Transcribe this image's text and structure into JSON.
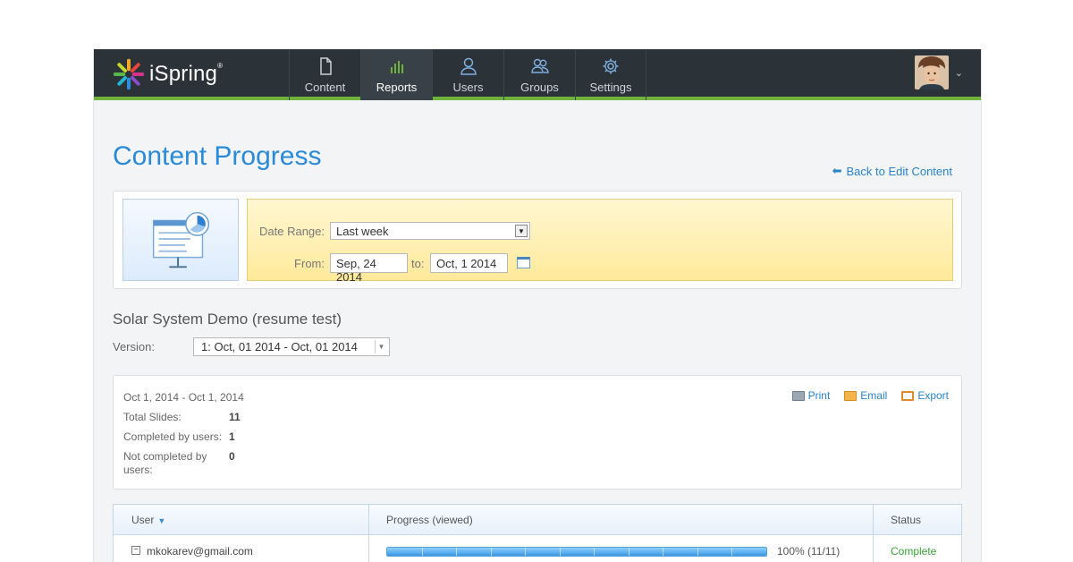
{
  "app": {
    "brand": "iSpring",
    "brand_mark": "®"
  },
  "nav": {
    "items": [
      {
        "label": "Content",
        "icon": "document-icon",
        "active": false
      },
      {
        "label": "Reports",
        "icon": "bar-chart-icon",
        "active": true
      },
      {
        "label": "Users",
        "icon": "user-icon",
        "active": false
      },
      {
        "label": "Groups",
        "icon": "users-group-icon",
        "active": false
      },
      {
        "label": "Settings",
        "icon": "gear-icon",
        "active": false
      }
    ]
  },
  "page": {
    "title": "Content Progress",
    "back_link": "Back to Edit Content"
  },
  "filter": {
    "date_range_label": "Date Range:",
    "date_range_value": "Last week",
    "from_label": "From:",
    "from_value": "Sep, 24 2014",
    "to_label": "to:",
    "to_value": "Oct, 1 2014"
  },
  "course": {
    "title": "Solar System Demo (resume test)",
    "version_label": "Version:",
    "version_value": "1: Oct, 01 2014 - Oct, 01 2014"
  },
  "summary": {
    "range": "Oct 1, 2014 - Oct 1, 2014",
    "rows": [
      {
        "key": "Total Slides:",
        "value": "11"
      },
      {
        "key": "Completed by users:",
        "value": "1"
      },
      {
        "key": "Not completed by users:",
        "value": "0"
      }
    ],
    "actions": [
      {
        "label": "Print",
        "icon": "printer-icon"
      },
      {
        "label": "Email",
        "icon": "email-icon"
      },
      {
        "label": "Export",
        "icon": "export-icon"
      }
    ]
  },
  "table": {
    "columns": [
      "User",
      "Progress (viewed)",
      "Status"
    ],
    "rows": [
      {
        "user": "mkokarev@gmail.com",
        "progress": 1.0,
        "progress_text": "100% (11/11)",
        "status": "Complete"
      }
    ]
  },
  "colors": {
    "accent_blue": "#2a8ad8",
    "header_bg": "#2b3238",
    "header_accent_green": "#6fb23c",
    "status_complete": "#3aa537"
  }
}
